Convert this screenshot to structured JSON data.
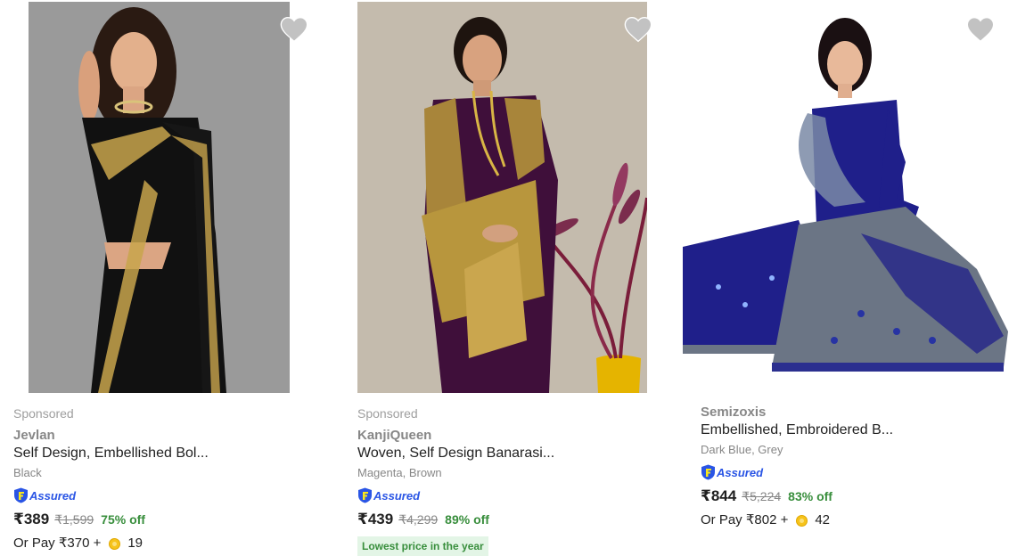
{
  "products": [
    {
      "sponsored": "Sponsored",
      "brand": "Jevlan",
      "title": "Self Design, Embellished Bol...",
      "color": "Black",
      "assured": "Assured",
      "price": "₹389",
      "mrp": "₹1,599",
      "discount": "75% off",
      "or_pay_prefix": "Or Pay ₹370 +",
      "coins": "19",
      "saree_color": "#111111",
      "border_color": "#c8a44c"
    },
    {
      "sponsored": "Sponsored",
      "brand": "KanjiQueen",
      "title": "Woven, Self Design Banarasi...",
      "color": "Magenta, Brown",
      "assured": "Assured",
      "price": "₹439",
      "mrp": "₹4,299",
      "discount": "89% off",
      "lowest_badge": "Lowest price in the year",
      "saree_color": "#3f0f3a",
      "border_color": "#b8963d"
    },
    {
      "brand": "Semizoxis",
      "title": "Embellished, Embroidered B...",
      "color": "Dark Blue, Grey",
      "assured": "Assured",
      "price": "₹844",
      "mrp": "₹5,224",
      "discount": "83% off",
      "or_pay_prefix": "Or Pay ₹802 +",
      "coins": "42",
      "saree_color": "#1f1f8a",
      "border_color": "#6b7585"
    }
  ],
  "icons": {
    "wishlist": "heart-icon",
    "assured": "assured-shield-icon",
    "coin": "supercoin-icon"
  }
}
